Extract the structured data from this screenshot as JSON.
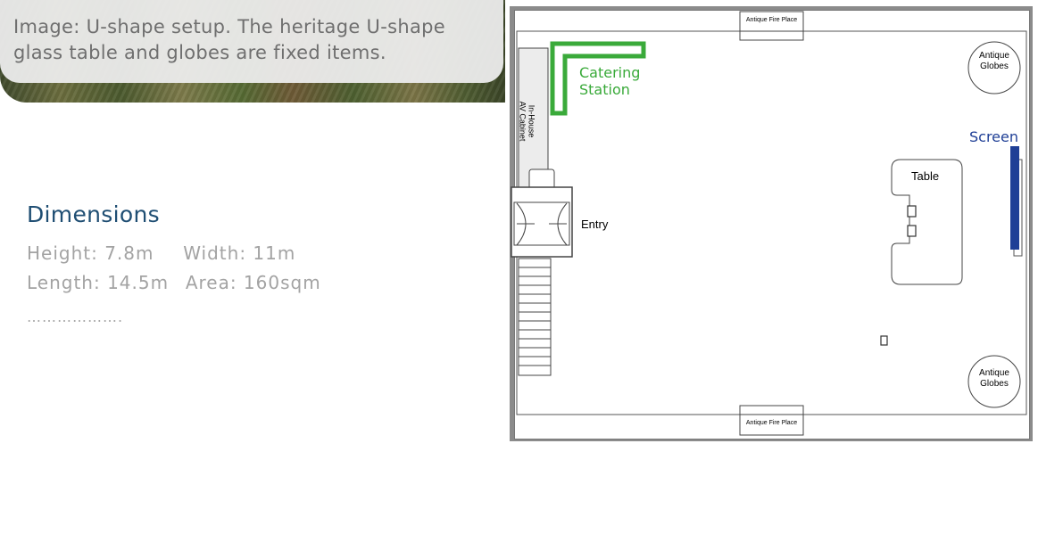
{
  "caption": {
    "text": "Image: U-shape setup. The heritage U-shape glass table and globes are fixed items."
  },
  "dimensions": {
    "title": "Dimensions",
    "height": "Height: 7.8m",
    "width": "Width: 11m",
    "length": "Length: 14.5m",
    "area": "Area: 160sqm",
    "dots": "………………."
  },
  "floorplan": {
    "fireplace_top": "Antique Fire Place",
    "fireplace_bottom": "Antique Fire Place",
    "globes_top_line1": "Antique",
    "globes_top_line2": "Globes",
    "globes_bottom_line1": "Antique",
    "globes_bottom_line2": "Globes",
    "catering_line1": "Catering",
    "catering_line2": "Station",
    "av_line1": "In-House",
    "av_line2": "AV Cabinet",
    "entry": "Entry",
    "table": "Table",
    "screen": "Screen",
    "colors": {
      "catering": "#3aaa3a",
      "screen": "#1f3f96",
      "title": "#1f4e73"
    }
  }
}
